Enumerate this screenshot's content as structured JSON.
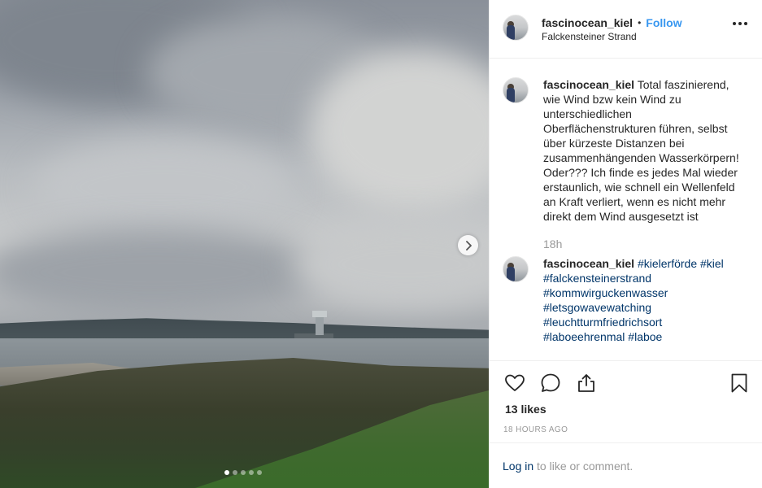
{
  "post": {
    "username": "fascinocean_kiel",
    "separator": "•",
    "follow_label": "Follow",
    "location": "Falckensteiner Strand",
    "more_icon": "more-horizontal-icon"
  },
  "carousel": {
    "next_icon": "chevron-right-icon",
    "slide_count": 5,
    "active_slide": 1
  },
  "caption": {
    "username": "fascinocean_kiel",
    "text": "Total faszinierend, wie Wind bzw kein Wind zu unterschiedlichen Oberflächenstrukturen führen, selbst über kürzeste Distanzen bei zusammenhängenden Wasserkörpern! Oder??? Ich finde es jedes Mal wieder erstaunlich, wie schnell ein Wellenfeld an Kraft verliert, wenn es nicht mehr direkt dem Wind ausgesetzt ist",
    "time": "18h"
  },
  "tags_comment": {
    "username": "fascinocean_kiel",
    "tags": [
      "#kielerförde",
      "#kiel",
      "#falckensteinerstrand",
      "#kommwirguckenwasser",
      "#letsgowavewatching",
      "#leuchtturmfriedrichsort",
      "#laboeehrenmal",
      "#laboe"
    ]
  },
  "actions": {
    "like_icon": "heart-icon",
    "comment_icon": "comment-icon",
    "share_icon": "share-icon",
    "save_icon": "bookmark-icon",
    "likes": "13 likes",
    "posted_ago": "18 HOURS AGO"
  },
  "login": {
    "link": "Log in",
    "text": " to like or comment."
  },
  "colors": {
    "accent": "#3897f0",
    "link": "#003569",
    "muted": "#999999",
    "text": "#262626"
  }
}
